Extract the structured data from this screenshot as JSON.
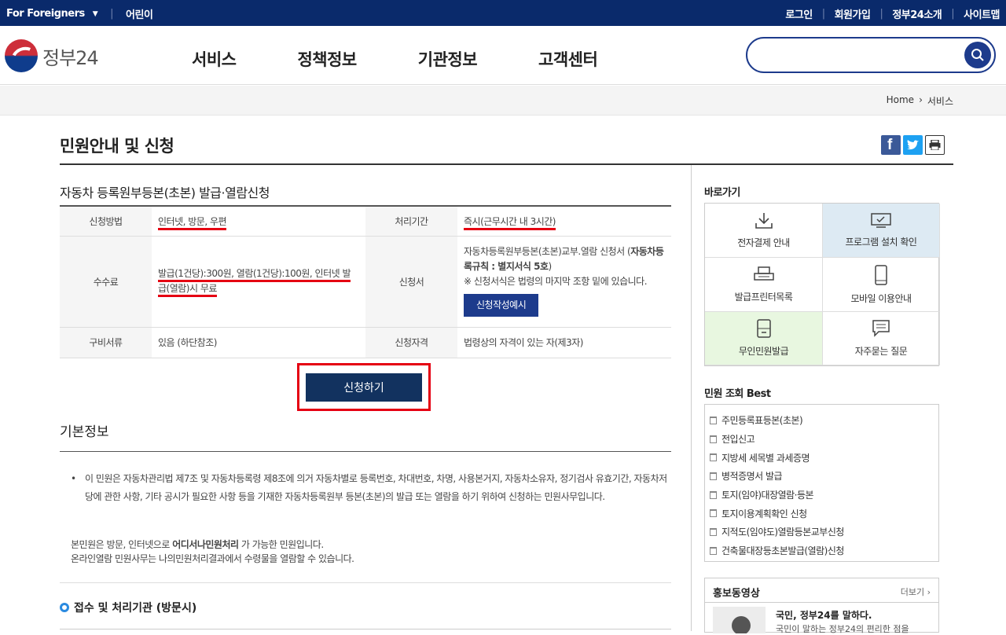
{
  "topbar": {
    "foreigners": "For Foreigners",
    "kids": "어린이",
    "login": "로그인",
    "signup": "회원가입",
    "about": "정부24소개",
    "sitemap": "사이트맵"
  },
  "header": {
    "logo_text": "정부24",
    "nav": [
      "서비스",
      "정책정보",
      "기관정보",
      "고객센터"
    ],
    "search_placeholder": ""
  },
  "breadcrumb": {
    "home": "Home",
    "current": "서비스"
  },
  "page": {
    "title": "민원안내 및 신청",
    "subtitle": "자동차 등록원부등본(초본) 발급·열람신청"
  },
  "info": {
    "method_label": "신청방법",
    "method_value": "인터넷, 방문, 우편",
    "period_label": "처리기간",
    "period_value": "즉시(근무시간 내 3시간)",
    "fee_label": "수수료",
    "fee_value_1": "발급(1건당):300원, 열람(1건당):100원, 인터넷 발",
    "fee_value_2": "급(열람)시 무료",
    "form_label": "신청서",
    "form_value_1": "자동차등록원부등본(초본)교부.열람 신청서 (",
    "form_value_bold": "자동차등록규칙 : 별지서식 5호",
    "form_value_2": ")",
    "form_note": "※ 신청서식은 법령의 마지막 조항 밑에 있습니다.",
    "form_button": "신청작성예시",
    "docs_label": "구비서류",
    "docs_value": "있음 (하단참조)",
    "qual_label": "신청자격",
    "qual_value": "법령상의 자격이 있는 자(제3자)"
  },
  "apply_button": "신청하기",
  "basic": {
    "title": "기본정보",
    "para": "이 민원은 자동차관리법 제7조 및 자동차등록령 제8조에 의거 자동차별로 등록번호, 차대번호, 차명, 사용본거지, 자동차소유자, 정기검사 유효기간, 자동차저당에 관한 사항, 기타 공시가 필요한 사항 등을 기재한 자동차등록원부 등본(초본)의 발급 또는 열람을 하기 위하여 신청하는 민원사무입니다.",
    "line1_a": "본민원은 방문, 인터넷으로 ",
    "line1_b": "어디서나민원처리",
    "line1_c": " 가 가능한 민원입니다.",
    "line2": "온라인열람 민원사무는 나의민원처리결과에서 수령물을 열람할 수 있습니다.",
    "section": "접수 및 처리기관 (방문시)"
  },
  "side": {
    "quick_title": "바로가기",
    "quick": [
      "전자결제 안내",
      "프로그램 설치 확인",
      "발급프린터목록",
      "모바일 이용안내",
      "무인민원발급",
      "자주묻는 질문"
    ],
    "best_title": "민원 조회 Best",
    "best": [
      "주민등록표등본(초본)",
      "전입신고",
      "지방세 세목별 과세증명",
      "병적증명서 발급",
      "토지(임야)대장열람·등본",
      "토지이용계획확인 신청",
      "지적도(임야도)열람등본교부신청",
      "건축물대장등초본발급(열람)신청"
    ],
    "promo_title": "홍보동영상",
    "promo_more": "더보기 ›",
    "promo_item": "국민, 정부24를 말하다.",
    "promo_desc": "국민이 말하는 정부24의 편리한 점을"
  }
}
